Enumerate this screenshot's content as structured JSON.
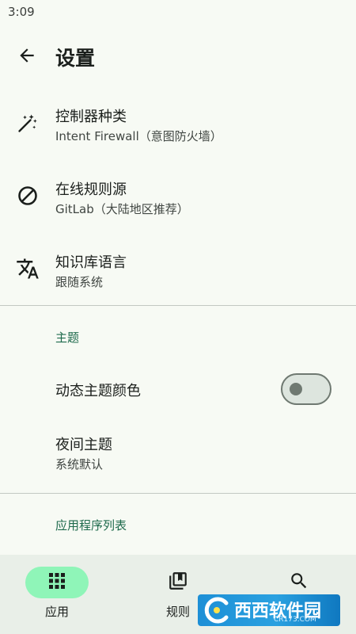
{
  "status_bar": {
    "time": "3:09"
  },
  "header": {
    "title": "设置",
    "back_icon": "arrow-back-icon"
  },
  "settings": [
    {
      "icon": "magic-wand-icon",
      "title": "控制器种类",
      "subtitle": "Intent Firewall（意图防火墙）"
    },
    {
      "icon": "block-icon",
      "title": "在线规则源",
      "subtitle": "GitLab（大陆地区推荐）"
    },
    {
      "icon": "translate-icon",
      "title": "知识库语言",
      "subtitle": "跟随系统"
    }
  ],
  "theme_section": {
    "header": "主题",
    "dynamic_color": {
      "title": "动态主题颜色",
      "enabled": false
    },
    "night_mode": {
      "title": "夜间主题",
      "subtitle": "系统默认"
    }
  },
  "app_list_section": {
    "header": "应用程序列表"
  },
  "bottom_nav": [
    {
      "icon": "apps-grid-icon",
      "label": "应用",
      "active": true
    },
    {
      "icon": "rules-book-icon",
      "label": "规则",
      "active": false
    },
    {
      "icon": "search-icon",
      "label": "",
      "active": false
    }
  ],
  "watermark": {
    "text": "西西软件园",
    "sub": "CR173.COM"
  },
  "colors": {
    "background": "#f7faf4",
    "accent": "#1e6a4c",
    "active_pill": "#8ff5b8",
    "nav_background": "#e9efe8",
    "divider": "#c3c8c2"
  }
}
